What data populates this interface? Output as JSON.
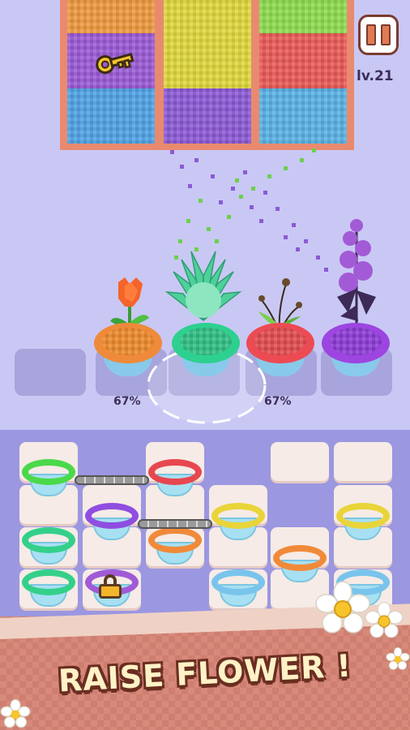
{
  "level": {
    "label": "lv.21"
  },
  "bins": [
    {
      "name": "bin-1",
      "layers": [
        "#ef9a3e",
        "#9b5ad6",
        "#4fa3e6"
      ]
    },
    {
      "name": "bin-2",
      "layers": [
        "#e0d83c",
        "#e0d83c",
        "#8c5ad6"
      ]
    },
    {
      "name": "bin-3",
      "layers": [
        "#8fdc4e",
        "#ea5a56",
        "#59b2e6"
      ]
    }
  ],
  "flowers": [
    {
      "name": "orange-tulip",
      "pot_color": "#ef8a3a",
      "soil": "#ee8a2a",
      "progress": "67%"
    },
    {
      "name": "green-succulent",
      "pot_color": "#2ed08f",
      "soil": "#2fbf84",
      "progress": ""
    },
    {
      "name": "red-sprout",
      "pot_color": "#ec4b53",
      "soil": "#e24b4e",
      "progress": "67%"
    },
    {
      "name": "purple-foxglove",
      "pot_color": "#9d45e0",
      "soil": "#8d3ad6",
      "progress": ""
    }
  ],
  "colors": {
    "background": "#c9c8f4",
    "board": "#9b97e0",
    "bin_frame": "#e98a6f",
    "banner": "#d7897a"
  },
  "icons": {
    "pause": "pause-icon",
    "key": "key-icon",
    "lock": "padlock-icon",
    "chain": "chain-icon",
    "daisy": "daisy-icon"
  },
  "banner": {
    "text": "RAISE FLOWER !"
  }
}
